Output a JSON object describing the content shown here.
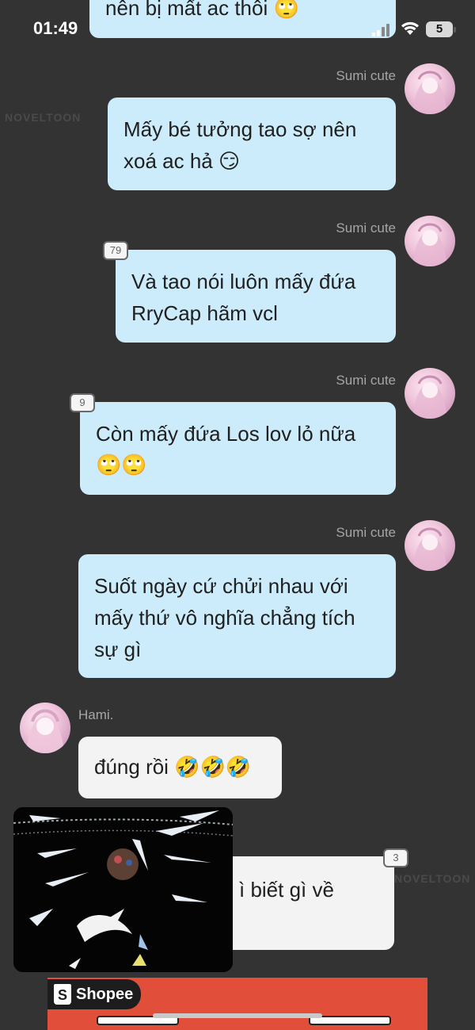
{
  "status_bar": {
    "time": "01:49",
    "battery": "5"
  },
  "watermarks": [
    "NOVELTOON",
    "NOVELTOON"
  ],
  "messages": [
    {
      "text": "nên bị mất ac thôi 🙄"
    },
    {
      "sender": "Sumi cute",
      "text_lines": [
        "Mấy bé tưởng tao sợ nên",
        "xoá ac hả 😏"
      ]
    },
    {
      "sender": "Sumi cute",
      "badge": "79",
      "text_lines": [
        "Và tao nói luôn mấy đứa",
        "RryCap hãm vcl"
      ]
    },
    {
      "sender": "Sumi cute",
      "badge": "9",
      "text_lines": [
        "Còn mấy đứa Los lov lỏ nữa",
        "🙄🙄"
      ]
    },
    {
      "sender": "Sumi cute",
      "text_lines": [
        "Suốt ngày cứ chửi nhau với",
        "mấy thứ vô nghĩa chẳng tích",
        "sự gì"
      ]
    },
    {
      "sender": "Hami.",
      "text": "đúng rồi 🤣🤣🤣"
    },
    {
      "badge": "3",
      "text": "ì biết gì về"
    }
  ],
  "ad": {
    "brand": "Shopee"
  }
}
